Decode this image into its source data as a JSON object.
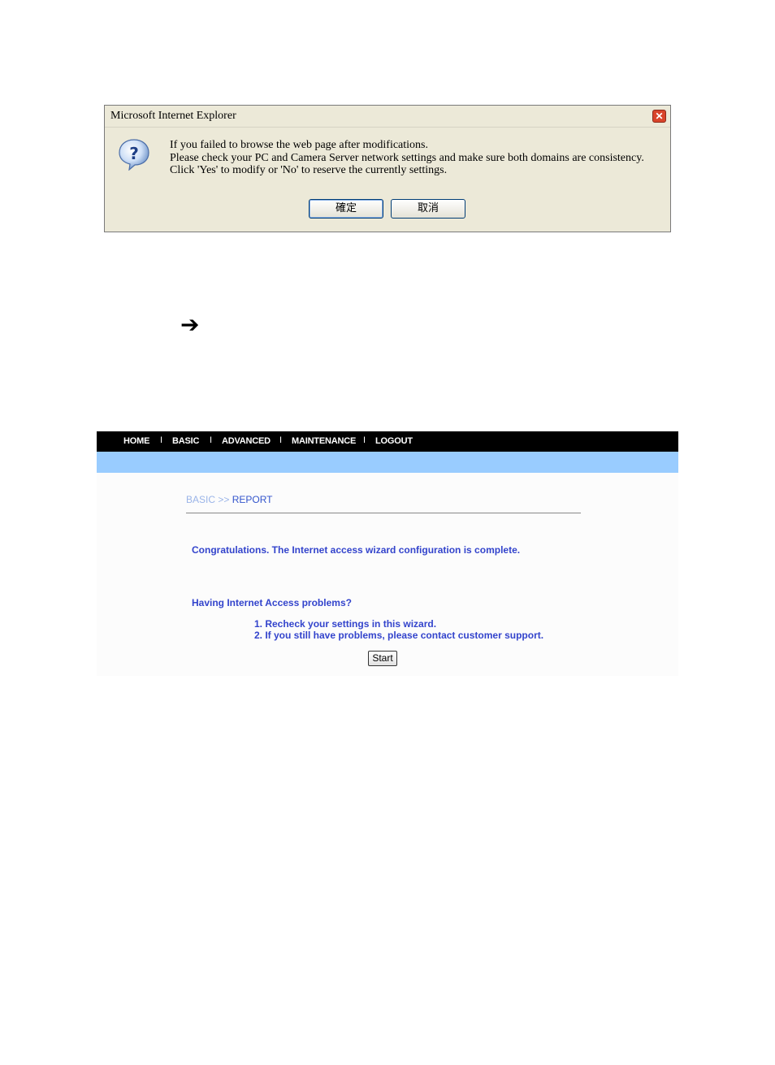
{
  "dialog": {
    "title": "Microsoft Internet Explorer",
    "close_glyph": "✕",
    "icon": "question-icon",
    "lines": [
      "If you failed to browse the web page after modifications.",
      "Please check your PC and Camera Server network settings and make sure both domains are consistency.",
      "Click 'Yes' to modify or 'No' to reserve the currently settings."
    ],
    "ok_label": "確定",
    "cancel_label": "取消"
  },
  "arrow": "➔",
  "webpage": {
    "nav": {
      "items": [
        "HOME",
        "BASIC",
        "ADVANCED",
        "MAINTENANCE",
        "LOGOUT"
      ],
      "separator": "I"
    },
    "breadcrumb": {
      "section": "BASIC",
      "separator": ">>",
      "page": "REPORT"
    },
    "congrats": "Congratulations. The Internet access wizard configuration is complete.",
    "problems_heading": "Having Internet Access problems?",
    "tips": [
      "1. Recheck your settings in this wizard.",
      "2. If you still have problems, please contact customer support."
    ],
    "start_label": "Start"
  },
  "colors": {
    "nav_bg": "#000000",
    "band": "#99ccff",
    "link_blue": "#3344cc",
    "dialog_bg": "#ece9d8"
  }
}
